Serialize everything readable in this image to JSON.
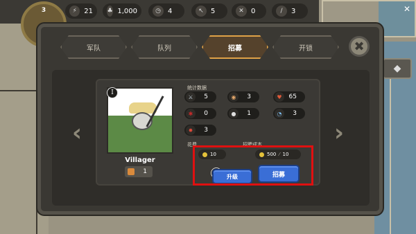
{
  "topbar": {
    "level": "3",
    "resources": [
      {
        "icon": "lightning-icon",
        "glyph": "⚡",
        "value": "21"
      },
      {
        "icon": "people-icon",
        "glyph": "♣",
        "value": "1,000"
      },
      {
        "icon": "clock-icon",
        "glyph": "◷",
        "value": "4"
      },
      {
        "icon": "cursor-icon",
        "glyph": "↖",
        "value": "5"
      },
      {
        "icon": "crossed-swords-icon",
        "glyph": "✕",
        "value": "0"
      },
      {
        "icon": "sword-icon",
        "glyph": "/",
        "value": "3"
      }
    ]
  },
  "dialog": {
    "tabs": [
      {
        "label": "军队",
        "active": false
      },
      {
        "label": "队列",
        "active": false
      },
      {
        "label": "招募",
        "active": true
      },
      {
        "label": "开锁",
        "active": false
      }
    ],
    "close_glyph": "✖",
    "prev_glyph": "‹",
    "next_glyph": "›"
  },
  "unit": {
    "badge_top": "I",
    "name": "Villager",
    "count": "1",
    "stats_title": "统计数据",
    "stats": [
      {
        "icon": "sword-icon",
        "value": "5"
      },
      {
        "icon": "shield-icon",
        "value": "3"
      },
      {
        "icon": "heart-icon",
        "value": "65"
      },
      {
        "icon": "blood-icon",
        "value": "0"
      },
      {
        "icon": "person-icon",
        "value": "1"
      },
      {
        "icon": "stopwatch-icon",
        "value": "3"
      },
      {
        "icon": "bug-icon",
        "value": "3"
      }
    ],
    "upgrade_cost_label": "花费",
    "recruit_cost_label": "招聘成本",
    "upgrade_cost": "10",
    "recruit_cost_gold": "500",
    "recruit_cost_other": "10",
    "badge_bottom": "II",
    "upgrade_label": "升级",
    "recruit_label": "招募"
  },
  "colors": {
    "accent": "#e0a247",
    "button": "#3a6ed6",
    "highlight": "#e01010"
  }
}
